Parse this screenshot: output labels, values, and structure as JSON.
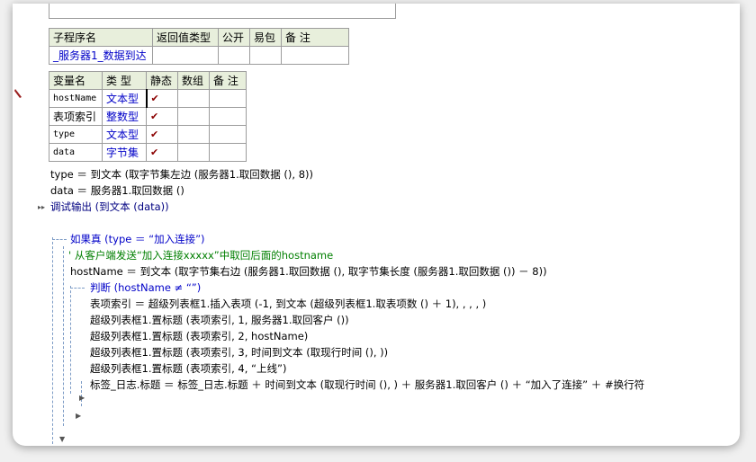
{
  "sub_table": {
    "headers": [
      "子程序名",
      "返回值类型",
      "公开",
      "易包",
      "备 注"
    ],
    "row": [
      "_服务器1_数据到达",
      "",
      "",
      "",
      ""
    ]
  },
  "var_table": {
    "headers": [
      "变量名",
      "类 型",
      "静态",
      "数组",
      "备 注"
    ],
    "rows": [
      {
        "name": "hostName",
        "type": "文本型",
        "static": "✔"
      },
      {
        "name": "表项索引",
        "type": "整数型",
        "static": "✔"
      },
      {
        "name": "type",
        "type": "文本型",
        "static": "✔"
      },
      {
        "name": "data",
        "type": "字节集",
        "static": "✔"
      }
    ]
  },
  "code": {
    "l1": "type ＝ 到文本 (取字节集左边 (服务器1.取回数据 (), 8))",
    "l2": "data ＝ 服务器1.取回数据 ()",
    "l3": "调试输出 (到文本 (data))",
    "l4": "如果真 (type ＝ “加入连接”)",
    "l5": "' 从客户端发送“加入连接xxxxx”中取回后面的hostname",
    "l6": "hostName ＝ 到文本 (取字节集右边 (服务器1.取回数据 (), 取字节集长度 (服务器1.取回数据 ()) － 8))",
    "l7": "判断 (hostName ≠ “”)",
    "l8": "表项索引 ＝ 超级列表框1.插入表项 (-1, 到文本 (超级列表框1.取表项数 () ＋ 1), , , , )",
    "l9": "超级列表框1.置标题 (表项索引, 1, 服务器1.取回客户 ())",
    "l10": "超级列表框1.置标题 (表项索引, 2, hostName)",
    "l11": "超级列表框1.置标题 (表项索引, 3, 时间到文本 (取现行时间 (), ))",
    "l12": "超级列表框1.置标题 (表项索引, 4, “上线”)",
    "l13": "标签_日志.标题 ＝ 标签_日志.标题 ＋ 时间到文本 (取现行时间 (), ) ＋ 服务器1.取回客户 () ＋ “加入了连接” ＋ #换行符"
  },
  "colors": {
    "header_bg": "#e8efdc",
    "keyword": "#0000c8",
    "comment": "#007f00",
    "check": "#8b0000"
  }
}
